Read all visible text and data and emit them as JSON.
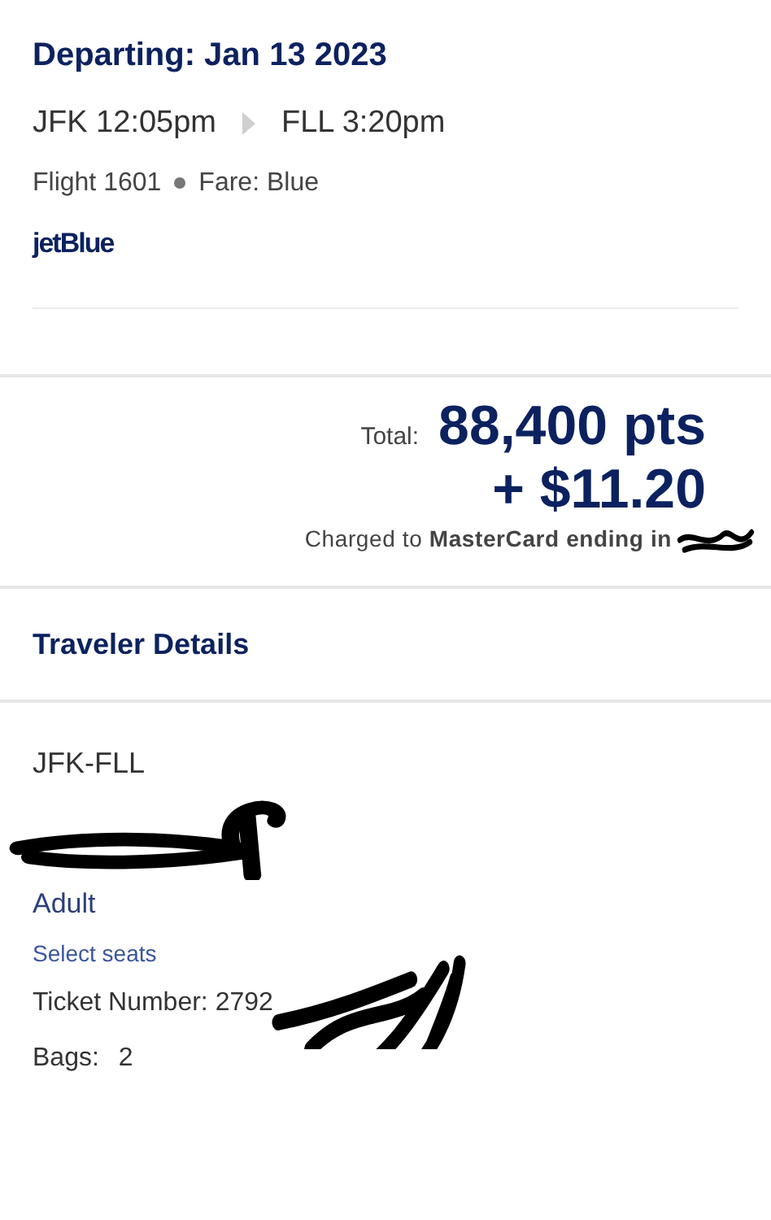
{
  "flight": {
    "title": "Departing: Jan 13 2023",
    "origin": "JFK 12:05pm",
    "destination": "FLL 3:20pm",
    "flight_number": "Flight 1601",
    "fare": "Fare: Blue",
    "airline_logo": "jetBlue"
  },
  "total": {
    "label": "Total:",
    "points": "88,400 pts",
    "cash": "+ $11.20",
    "charged_to": "Charged to **MasterCard ending in**"
  },
  "traveler_details": {
    "title": "Traveler Details",
    "route": "JFK-FLL",
    "passenger_type": "Adult",
    "select_seats": "Select seats",
    "ticket_number": "Ticket Number: 2792",
    "bags": "Bags:",
    "bags_count": "2"
  }
}
